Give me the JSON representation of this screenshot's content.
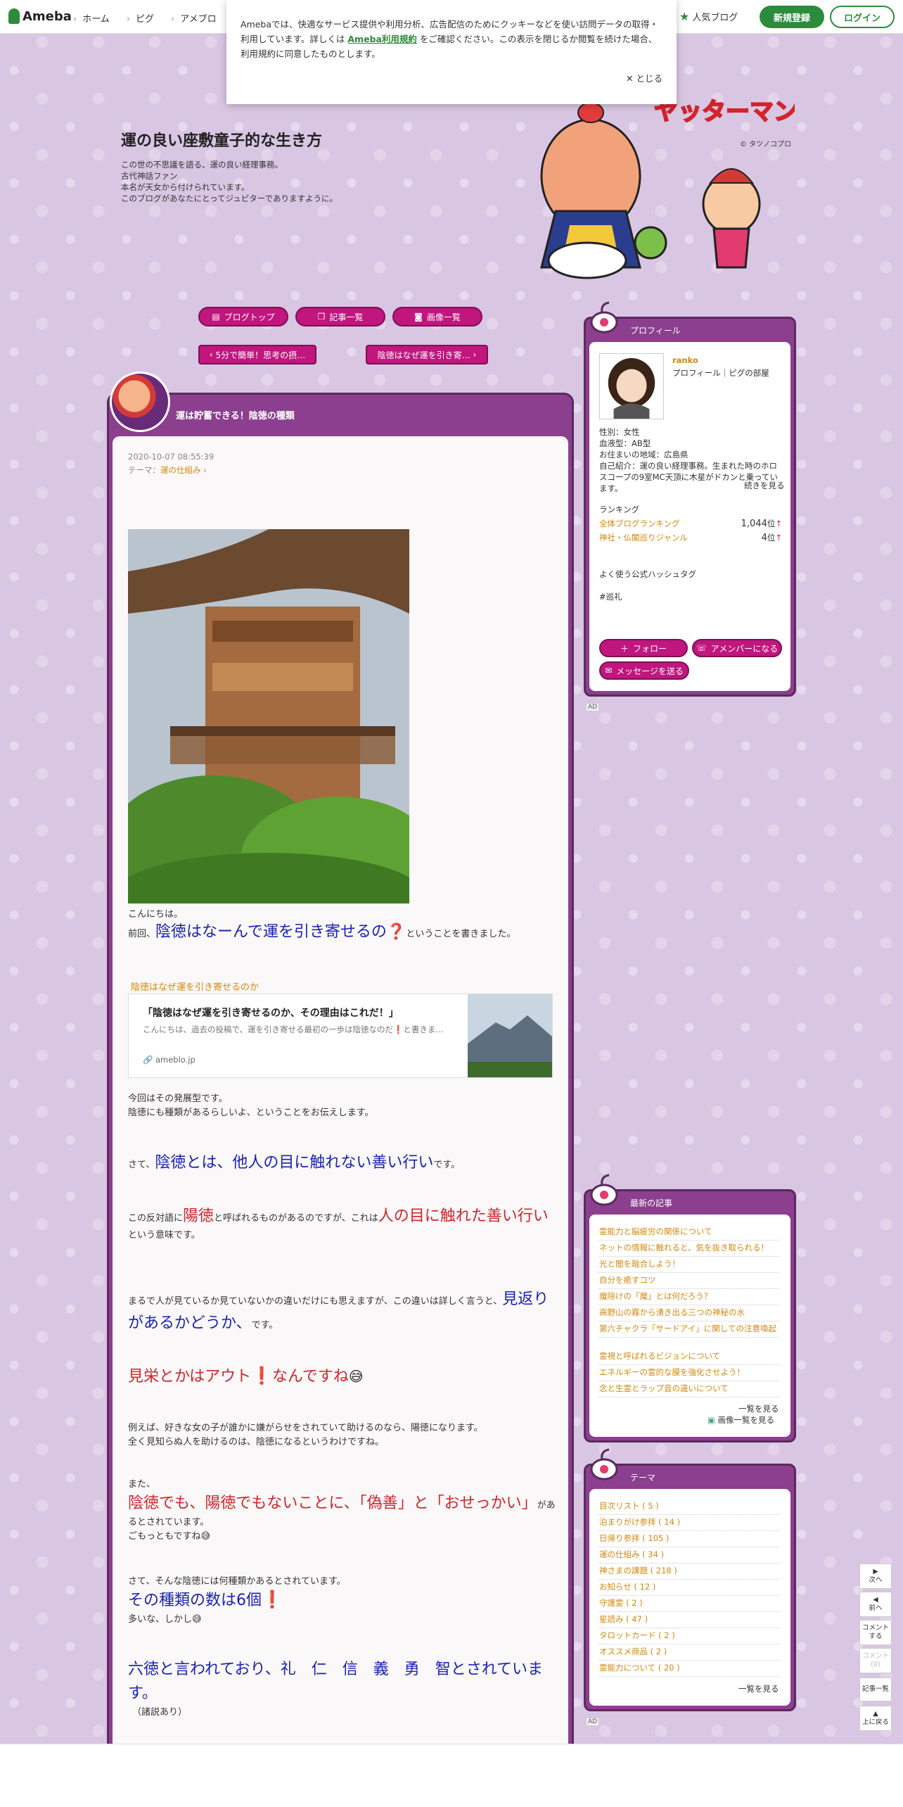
{
  "topbar": {
    "logo_text": "Ameba",
    "nav": [
      "ホーム",
      "ピグ",
      "アメブロ"
    ],
    "popular_blog": "人気ブログ",
    "signup": "新規登録",
    "login": "ログイン"
  },
  "cookie": {
    "text_before": "Amebaでは、快適なサービス提供や利用分析、広告配信のためにクッキーなどを使い訪問データの取得・利用しています。詳しくは",
    "link": "Ameba利用規約",
    "text_after": "をご確認ください。この表示を閉じるか閲覧を続けた場合、利用規約に同意したものとします。",
    "close": "✕ とじる"
  },
  "header": {
    "title": "運の良い座敷童子的な生き方",
    "desc": [
      "この世の不思議を語る、運の良い経理事務。",
      "古代神話ファン",
      "本名が天女から付けられています。",
      "このブログがあなたにとってジュピターでありますように。"
    ],
    "credit": "© タツノコプロ"
  },
  "nav_buttons": {
    "blog_top": "ブログトップ",
    "entries": "記事一覧",
    "images": "画像一覧"
  },
  "pager": {
    "prev": "5分で簡単！思考の摂…",
    "next": "陰徳はなぜ運を引き寄…"
  },
  "entry": {
    "title": "運は貯蓄できる！陰徳の種類",
    "date": "2020-10-07 08:55:39",
    "theme_label": "テーマ：",
    "theme": "運の仕組み",
    "p1": "こんにちは。",
    "p2_a": "前回、",
    "p2_big": "陰徳はなーんで運を引き寄せるの",
    "p2_mark": "❓",
    "p2_b": "ということを書きました。",
    "card_label": "陰徳はなぜ運を引き寄せるのか",
    "card_title": "「陰徳はなぜ運を引き寄せるのか、その理由はこれだ！」",
    "card_desc": "こんにちは、過去の投稿で、運を引き寄せる最初の一歩は陰徳なのだ❗と書きま…",
    "card_url": "ameblo.jp",
    "p3_a": "今回はその発展型です。",
    "p3_b": "陰徳にも種類があるらしいよ、ということをお伝えします。",
    "p4_a": "さて、",
    "p4_big": "陰徳とは、他人の目に触れない善い行い",
    "p4_b": "です。",
    "p5_a": "この反対語に",
    "p5_red1": "陽徳",
    "p5_b": "と呼ばれるものがあるのですが、これは",
    "p5_red2": "人の目に触れた善い行い",
    "p5_c": "という意味です。",
    "p6_a": "まるで人が見ているか見ていないかの違いだけにも思えますが、この違いは詳しく言うと、",
    "p6_big": "見返りがあるかどうか、",
    "p6_b": "です。",
    "p7_red": "見栄とかはアウト",
    "p7_mark": "❗",
    "p7_red2": "なんですね",
    "p7_emoji": "😅",
    "p8_a": "例えば、好きな女の子が誰かに嫌がらせをされていて助けるのなら、陽徳になります。",
    "p8_b": "全く見知らぬ人を助けるのは、陰徳になるというわけですね。",
    "p9_a": "また、",
    "p9_red": "陰徳でも、陽徳でもないことに、「偽善」と「おせっかい」",
    "p9_b": "があるとされています。",
    "p9_c": "ごもっともですね",
    "p10_a": "さて、そんな陰徳には何種類かあるとされています。",
    "p10_big": "その種類の数は6個",
    "p10_mark": "❗",
    "p10_b": "多いな、しかし",
    "p11_big": "六徳と言われており、礼　仁　信　義　勇　智とされています。",
    "p11_b": "（諸説あり）"
  },
  "profile": {
    "head": "プロフィール",
    "name": "ranko",
    "links": "プロフィール｜ピグの部屋",
    "gender": "性別：女性",
    "blood": "血液型：AB型",
    "area": "お住まいの地域：広島県",
    "intro": "自己紹介：運の良い経理事務。生まれた時のホロスコープの9室MC天頂に木星がドカンと乗っています。",
    "more": "続きを見る",
    "ranking_label": "ランキング",
    "rank1_label": "全体ブログランキング",
    "rank1_value": "1,044",
    "rank2_label": "神社・仏閣巡りジャンル",
    "rank2_value": "4",
    "rank_unit": "位",
    "hashtag_label": "よく使う公式ハッシュタグ",
    "hashtag": "#巡礼",
    "follow": "フォロー",
    "member": "アメンバーになる",
    "message": "メッセージを送る"
  },
  "latest": {
    "head": "最新の記事",
    "items": [
      "霊能力と脳疲労の関係について",
      "ネットの情報に触れると、気を抜き取られる！",
      "光と闇を融合しよう！",
      "自分を癒すコツ",
      "魔除けの「魔」とは何だろう？",
      "高野山の霧から湧き出る三つの神秘の水",
      "第六チャクラ「サードアイ」に関しての注意喚起",
      "霊視と呼ばれるビジョンについて",
      "エネルギーの霊的な膜を強化させよう！",
      "念と生霊とラップ音の違いについて"
    ],
    "more": "一覧を見る",
    "images": "画像一覧を見る"
  },
  "theme_box": {
    "head": "テーマ",
    "items": [
      "目次リスト ( 5 )",
      "泊まりがけ参拝 ( 14 )",
      "日帰り参拝 ( 105 )",
      "運の仕組み ( 34 )",
      "神さまの課題 ( 218 )",
      "お知らせ ( 12 )",
      "守護霊 ( 2 )",
      "星読み ( 47 )",
      "タロットカード ( 2 )",
      "オススメ商品 ( 2 )",
      "霊能力について ( 20 )"
    ],
    "more": "一覧を見る"
  },
  "ad_label": "AD",
  "floatnav": {
    "next": "次へ",
    "prev": "前へ",
    "comment": "コメントする",
    "comment_count": "コメント(0)",
    "list": "記事一覧",
    "top": "上に戻る"
  },
  "colors": {
    "accent": "#c0167e",
    "frame": "#8b3f8e",
    "link": "#d4880f",
    "brand": "#2d8c3c"
  }
}
